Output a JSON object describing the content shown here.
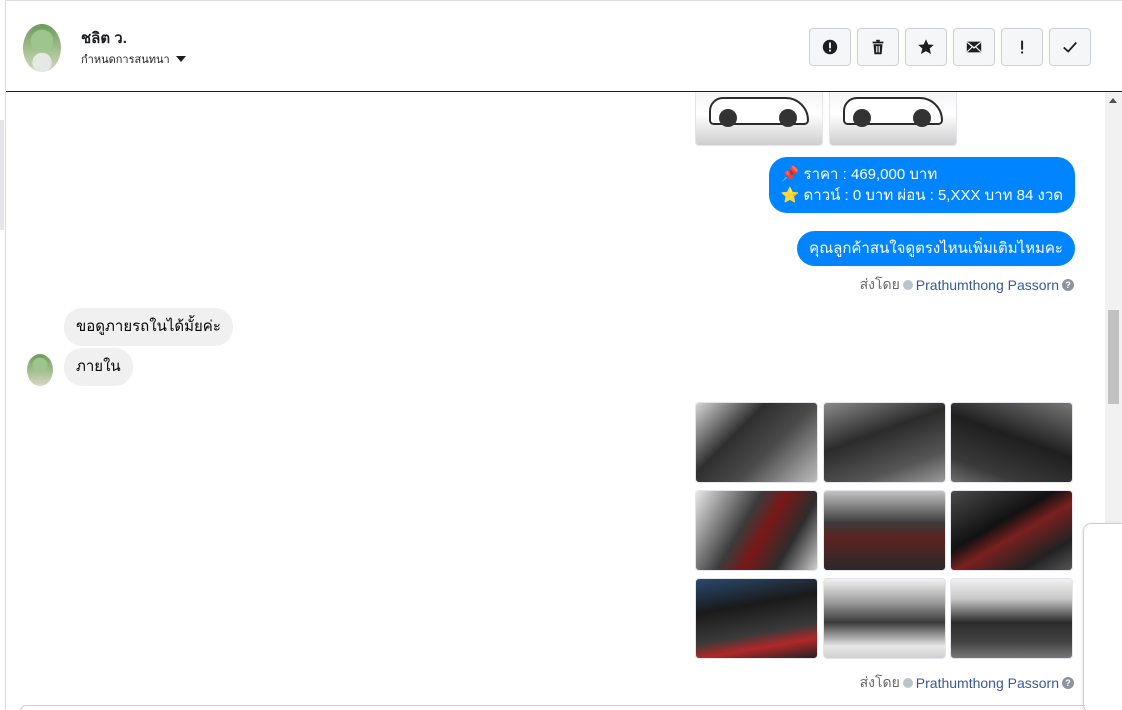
{
  "header": {
    "contact_name": "ชลิต ว.",
    "conversation_setting": "กำหนดการสนทนา",
    "toolbar": [
      {
        "id": "spam",
        "icon": "exclamation-circle-icon"
      },
      {
        "id": "delete",
        "icon": "trash-icon"
      },
      {
        "id": "star",
        "icon": "star-icon"
      },
      {
        "id": "unread",
        "icon": "envelope-icon"
      },
      {
        "id": "priority",
        "icon": "exclamation-icon"
      },
      {
        "id": "done",
        "icon": "checkmark-icon"
      }
    ]
  },
  "messages": {
    "price_line": "📌 ราคา : 469,000 บาท",
    "down_line": "⭐ ดาวน์ : 0 บาท ผ่อน : 5,XXX บาท 84 งวด",
    "question": "คุณลูกค้าสนใจดูตรงไหนเพิ่มเติมไหมคะ",
    "customer_1": "ขอดูภายรถในได้มั้ยค่ะ",
    "customer_2": "ภายใน"
  },
  "sent_by": {
    "label": "ส่งโดย",
    "agent": "Prathumthong Passorn",
    "help": "?"
  },
  "colors": {
    "outgoing_bubble": "#0084ff",
    "incoming_bubble": "#f1f0f0",
    "agent_link": "#385898"
  }
}
